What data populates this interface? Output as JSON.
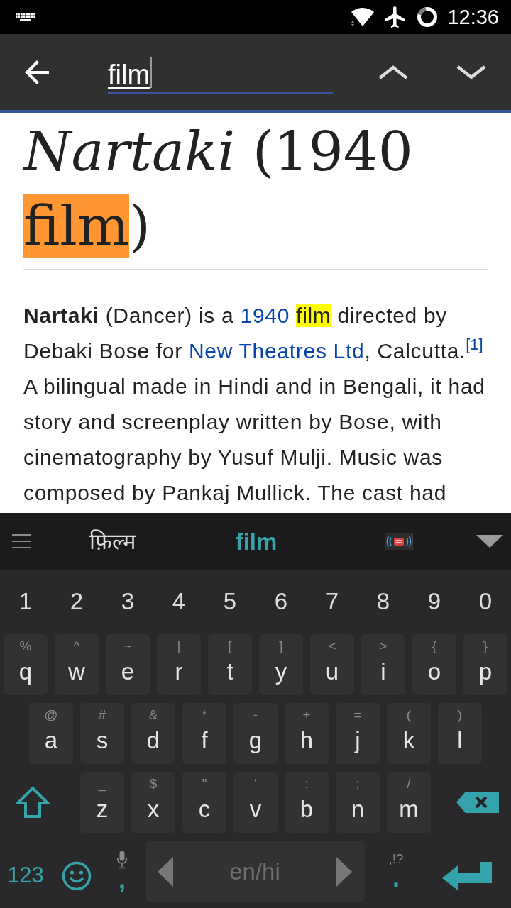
{
  "status_bar": {
    "time": "12:36"
  },
  "find_bar": {
    "query": "film"
  },
  "article": {
    "title": [
      {
        "kind": "text",
        "text": "*Nartaki* (1940 "
      },
      {
        "kind": "match",
        "text": "film",
        "selected": true
      },
      {
        "kind": "text",
        "text": ")"
      }
    ],
    "paragraph": [
      {
        "kind": "text",
        "text": "**Nartaki** (Dancer) is a "
      },
      {
        "kind": "link",
        "text": "1940",
        "space_after": true
      },
      {
        "kind": "match",
        "text": "film",
        "selected": false
      },
      {
        "kind": "text",
        "text": " directed by Debaki Bose for "
      },
      {
        "kind": "link",
        "text": "New Theatres Ltd"
      },
      {
        "kind": "text",
        "text": ", Calcutta."
      },
      {
        "kind": "ref",
        "text": "[1]"
      },
      {
        "kind": "text",
        "text": " A bilingual made in Hindi and in Bengali, it had story and screenplay written by Bose, with cinematography by Yusuf Mulji. Music was composed by Pankaj Mullick. The cast had"
      }
    ]
  },
  "keyboard": {
    "suggestions": [
      {
        "kind": "word",
        "text": "फ़िल्म",
        "selected": false
      },
      {
        "kind": "word",
        "text": "film",
        "selected": true
      },
      {
        "kind": "emoji",
        "selected": false
      }
    ],
    "number_row": [
      "1",
      "2",
      "3",
      "4",
      "5",
      "6",
      "7",
      "8",
      "9",
      "0"
    ],
    "letter_rows": [
      {
        "keys": [
          {
            "kind": "letter",
            "label": "q",
            "hint": "%"
          },
          {
            "kind": "letter",
            "label": "w",
            "hint": "^"
          },
          {
            "kind": "letter",
            "label": "e",
            "hint": "~"
          },
          {
            "kind": "letter",
            "label": "r",
            "hint": "|"
          },
          {
            "kind": "letter",
            "label": "t",
            "hint": "["
          },
          {
            "kind": "letter",
            "label": "y",
            "hint": "]"
          },
          {
            "kind": "letter",
            "label": "u",
            "hint": "<"
          },
          {
            "kind": "letter",
            "label": "i",
            "hint": ">"
          },
          {
            "kind": "letter",
            "label": "o",
            "hint": "{"
          },
          {
            "kind": "letter",
            "label": "p",
            "hint": "}"
          }
        ]
      },
      {
        "keys": [
          {
            "kind": "letter",
            "label": "a",
            "hint": "@"
          },
          {
            "kind": "letter",
            "label": "s",
            "hint": "#"
          },
          {
            "kind": "letter",
            "label": "d",
            "hint": "&"
          },
          {
            "kind": "letter",
            "label": "f",
            "hint": "*"
          },
          {
            "kind": "letter",
            "label": "g",
            "hint": "-"
          },
          {
            "kind": "letter",
            "label": "h",
            "hint": "+"
          },
          {
            "kind": "letter",
            "label": "j",
            "hint": "="
          },
          {
            "kind": "letter",
            "label": "k",
            "hint": "("
          },
          {
            "kind": "letter",
            "label": "l",
            "hint": ")"
          }
        ]
      },
      {
        "keys": [
          {
            "kind": "shift"
          },
          {
            "kind": "letter",
            "label": "z",
            "hint": "_"
          },
          {
            "kind": "letter",
            "label": "x",
            "hint": "$"
          },
          {
            "kind": "letter",
            "label": "c",
            "hint": "\""
          },
          {
            "kind": "letter",
            "label": "v",
            "hint": "'"
          },
          {
            "kind": "letter",
            "label": "b",
            "hint": ":"
          },
          {
            "kind": "letter",
            "label": "n",
            "hint": ";"
          },
          {
            "kind": "letter",
            "label": "m",
            "hint": "/"
          },
          {
            "kind": "backspace"
          }
        ]
      }
    ],
    "bottom_row": {
      "keys": [
        {
          "kind": "symbols",
          "label": "123"
        },
        {
          "kind": "emoji"
        },
        {
          "kind": "voice-punct",
          "label": ","
        },
        {
          "kind": "space",
          "label": "en/hi"
        },
        {
          "kind": "punct",
          "label": ".",
          "hint": ",!?"
        },
        {
          "kind": "enter"
        }
      ]
    }
  }
}
